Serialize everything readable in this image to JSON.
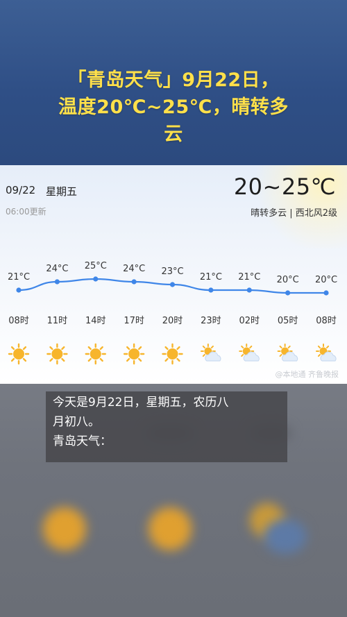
{
  "headline": {
    "line1": "「青岛天气」9月22日，",
    "line2": "温度20℃~25℃，晴转多",
    "line3": "云"
  },
  "card": {
    "date": "09/22",
    "weekday": "星期五",
    "updated": "06:00更新",
    "temp_range": "20~25℃",
    "condition": "晴转多云 | 西北风2级",
    "watermark": "@本地通  齐鲁晚报"
  },
  "chart_data": {
    "type": "line",
    "x": [
      "08时",
      "11时",
      "14时",
      "17时",
      "20时",
      "23时",
      "02时",
      "05时",
      "08时"
    ],
    "values": [
      21,
      24,
      25,
      24,
      23,
      21,
      21,
      20,
      20
    ],
    "value_labels": [
      "21°C",
      "24°C",
      "25°C",
      "24°C",
      "23°C",
      "21°C",
      "21°C",
      "20°C",
      "20°C"
    ],
    "icons": [
      "sun-icon",
      "sun-icon",
      "sun-icon",
      "sun-icon",
      "sun-icon",
      "partly-cloudy-icon",
      "partly-cloudy-icon",
      "partly-cloudy-icon",
      "partly-cloudy-icon"
    ],
    "ylim": [
      19,
      26
    ],
    "line_color": "#3f86e8",
    "grid": false
  },
  "caption": {
    "line1": "今天是9月22日，星期五，农历八",
    "line2": "月初八。",
    "line3": "青岛天气："
  },
  "colors": {
    "headline": "#ffe04a",
    "banner": "#2f4f86",
    "sun": "#f7b52c"
  }
}
